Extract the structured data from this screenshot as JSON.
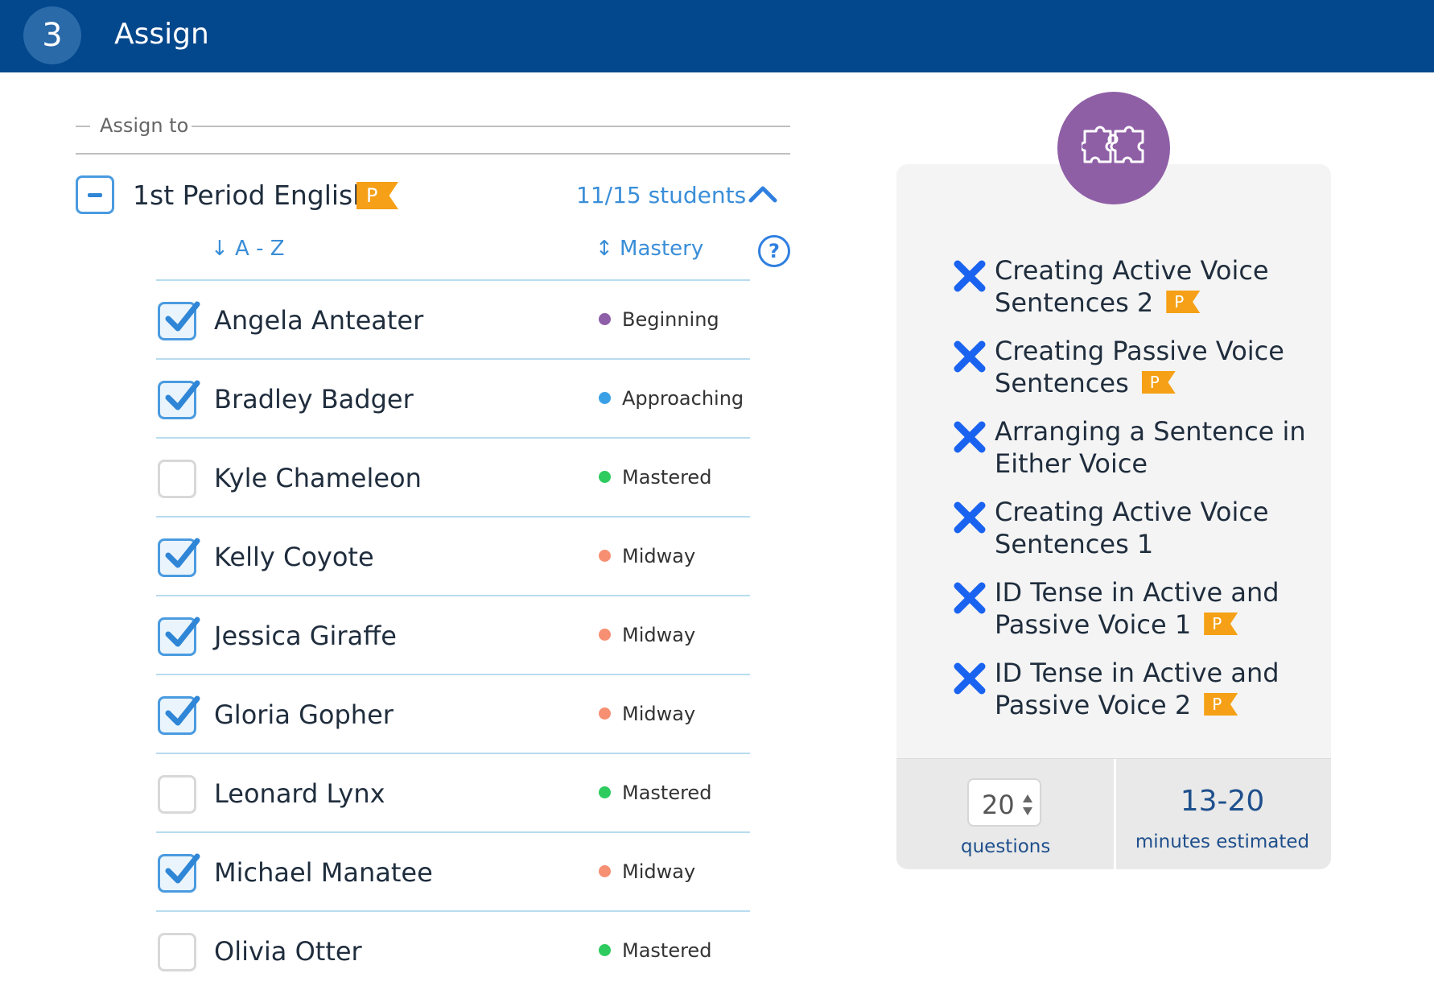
{
  "header": {
    "step": "3",
    "title": "Assign"
  },
  "assign_to": {
    "label": "Assign to"
  },
  "class": {
    "name": "1st Period English",
    "badge": "P",
    "students_count": "11/15 students"
  },
  "sort": {
    "az_label": "↓ A - Z",
    "mastery_label": "↕ Mastery",
    "help": "?"
  },
  "colors": {
    "header_bg": "#03478c",
    "beginning": "#8e5ea8",
    "approaching": "#3aa0e6",
    "mastered": "#2ecb5e",
    "midway": "#f78f73",
    "badge": "#f5a016",
    "x_icon": "#1a63f0"
  },
  "students": [
    {
      "name": "Angela Anteater",
      "checked": true,
      "mastery": "Beginning",
      "dot": "#8e5ea8"
    },
    {
      "name": "Bradley Badger",
      "checked": true,
      "mastery": "Approaching",
      "dot": "#3aa0e6"
    },
    {
      "name": "Kyle Chameleon",
      "checked": false,
      "mastery": "Mastered",
      "dot": "#2ecb5e"
    },
    {
      "name": "Kelly Coyote",
      "checked": true,
      "mastery": "Midway",
      "dot": "#f78f73"
    },
    {
      "name": "Jessica Giraffe",
      "checked": true,
      "mastery": "Midway",
      "dot": "#f78f73"
    },
    {
      "name": "Gloria Gopher",
      "checked": true,
      "mastery": "Midway",
      "dot": "#f78f73"
    },
    {
      "name": "Leonard Lynx",
      "checked": false,
      "mastery": "Mastered",
      "dot": "#2ecb5e"
    },
    {
      "name": "Michael Manatee",
      "checked": true,
      "mastery": "Midway",
      "dot": "#f78f73"
    },
    {
      "name": "Olivia Otter",
      "checked": false,
      "mastery": "Mastered",
      "dot": "#2ecb5e"
    }
  ],
  "skills": [
    {
      "line1": "Creating Active Voice",
      "line2": "Sentences 2",
      "badge": "P"
    },
    {
      "line1": "Creating Passive Voice",
      "line2": "Sentences",
      "badge": "P"
    },
    {
      "line1": "Arranging a Sentence in",
      "line2": "Either Voice",
      "badge": ""
    },
    {
      "line1": "Creating Active Voice",
      "line2": "Sentences 1",
      "badge": ""
    },
    {
      "line1": "ID Tense in Active and",
      "line2": "Passive Voice 1",
      "badge": "P"
    },
    {
      "line1": "ID Tense in Active and",
      "line2": "Passive Voice 2",
      "badge": "P"
    }
  ],
  "footer": {
    "questions_value": "20",
    "questions_label": "questions",
    "time_value": "13-20",
    "time_label": "minutes estimated"
  }
}
